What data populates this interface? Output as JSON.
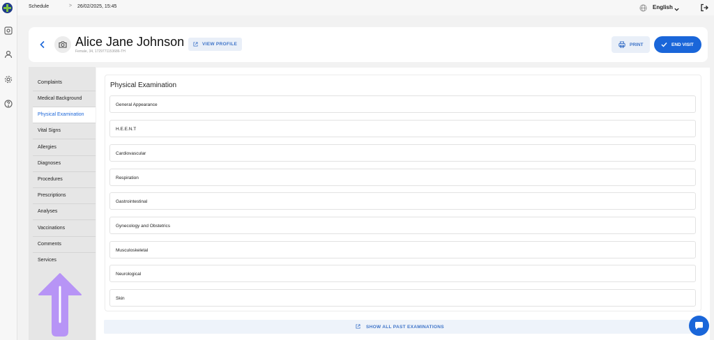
{
  "breadcrumb": {
    "section": "Schedule",
    "separator": ">",
    "datetime": "26/02/2025, 15:45"
  },
  "language": {
    "selected": "English"
  },
  "patient": {
    "name": "Alice Jane Johnson",
    "meta": "Female, 34, 1729771153686-TH",
    "view_profile_label": "VIEW PROFILE"
  },
  "actions": {
    "print_label": "PRINT",
    "end_visit_label": "END VISIT"
  },
  "sidenav": {
    "items": [
      {
        "label": "Complaints",
        "active": false
      },
      {
        "label": "Medical Background",
        "active": false
      },
      {
        "label": "Physical Examination",
        "active": true
      },
      {
        "label": "Vital Signs",
        "active": false
      },
      {
        "label": "Allergies",
        "active": false
      },
      {
        "label": "Diagnoses",
        "active": false
      },
      {
        "label": "Procedures",
        "active": false
      },
      {
        "label": "Prescriptions",
        "active": false
      },
      {
        "label": "Analyses",
        "active": false
      },
      {
        "label": "Vaccinations",
        "active": false
      },
      {
        "label": "Comments",
        "active": false
      },
      {
        "label": "Services",
        "active": false
      }
    ]
  },
  "exam": {
    "title": "Physical Examination",
    "sections": [
      "General Appearance",
      "H.E.E.N.T",
      "Cardiovascular",
      "Respiration",
      "Gastrointestinal",
      "Gynecology and Obstetrics",
      "Musculoskeletal",
      "Neurological",
      "Skin"
    ],
    "show_past_label": "SHOW ALL PAST EXAMINATIONS"
  },
  "colors": {
    "accent": "#1a66d9",
    "annotation_arrow": "#b794f6"
  }
}
